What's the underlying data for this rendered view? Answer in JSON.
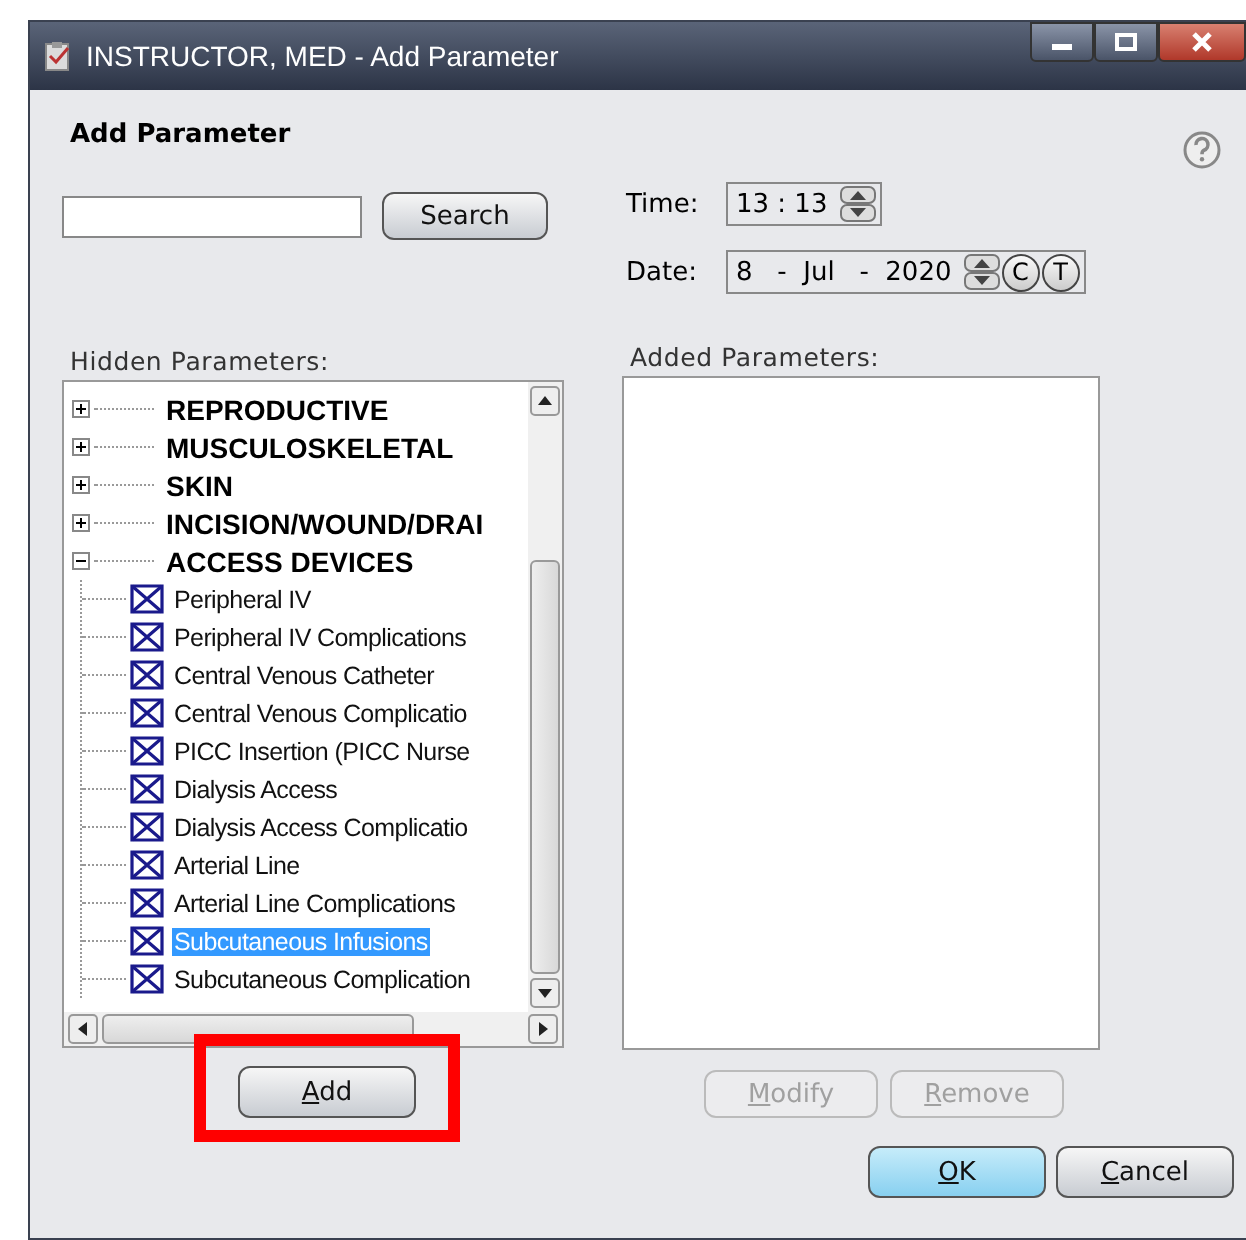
{
  "window": {
    "title": "INSTRUCTOR, MED - Add Parameter"
  },
  "heading": "Add Parameter",
  "search": {
    "button": "Search"
  },
  "time": {
    "label": "Time:",
    "hours": "13",
    "separator": ":",
    "minutes": "13"
  },
  "date": {
    "label": "Date:",
    "day": "8",
    "separator": "-",
    "month": "Jul",
    "year": "2020",
    "buttons": [
      "C",
      "T"
    ]
  },
  "hidden": {
    "label": "Hidden Parameters:",
    "items": [
      {
        "label": "REPRODUCTIVE",
        "expanded": false
      },
      {
        "label": "MUSCULOSKELETAL",
        "expanded": false
      },
      {
        "label": "SKIN",
        "expanded": false
      },
      {
        "label": "INCISION/WOUND/DRAI",
        "expanded": false
      },
      {
        "label": "ACCESS DEVICES",
        "expanded": true,
        "children": [
          {
            "label": "Peripheral IV",
            "selected": false
          },
          {
            "label": "Peripheral IV Complications",
            "selected": false
          },
          {
            "label": "Central Venous Catheter",
            "selected": false
          },
          {
            "label": "Central Venous Complicatio",
            "selected": false
          },
          {
            "label": "PICC Insertion (PICC Nurse",
            "selected": false
          },
          {
            "label": "Dialysis Access",
            "selected": false
          },
          {
            "label": "Dialysis Access Complicatio",
            "selected": false
          },
          {
            "label": "Arterial Line",
            "selected": false
          },
          {
            "label": "Arterial Line Complications",
            "selected": false
          },
          {
            "label": "Subcutaneous Infusions",
            "selected": true
          },
          {
            "label": "Subcutaneous Complication",
            "selected": false
          }
        ]
      }
    ]
  },
  "add_button": {
    "label": "Add",
    "highlighted": true
  },
  "added": {
    "label": "Added Parameters:"
  },
  "edit_buttons": [
    {
      "label": "Modify",
      "disabled": true
    },
    {
      "label": "Remove",
      "disabled": true
    }
  ],
  "dialog_buttons": [
    {
      "label": "OK",
      "default": true
    },
    {
      "label": "Cancel",
      "default": false
    }
  ]
}
